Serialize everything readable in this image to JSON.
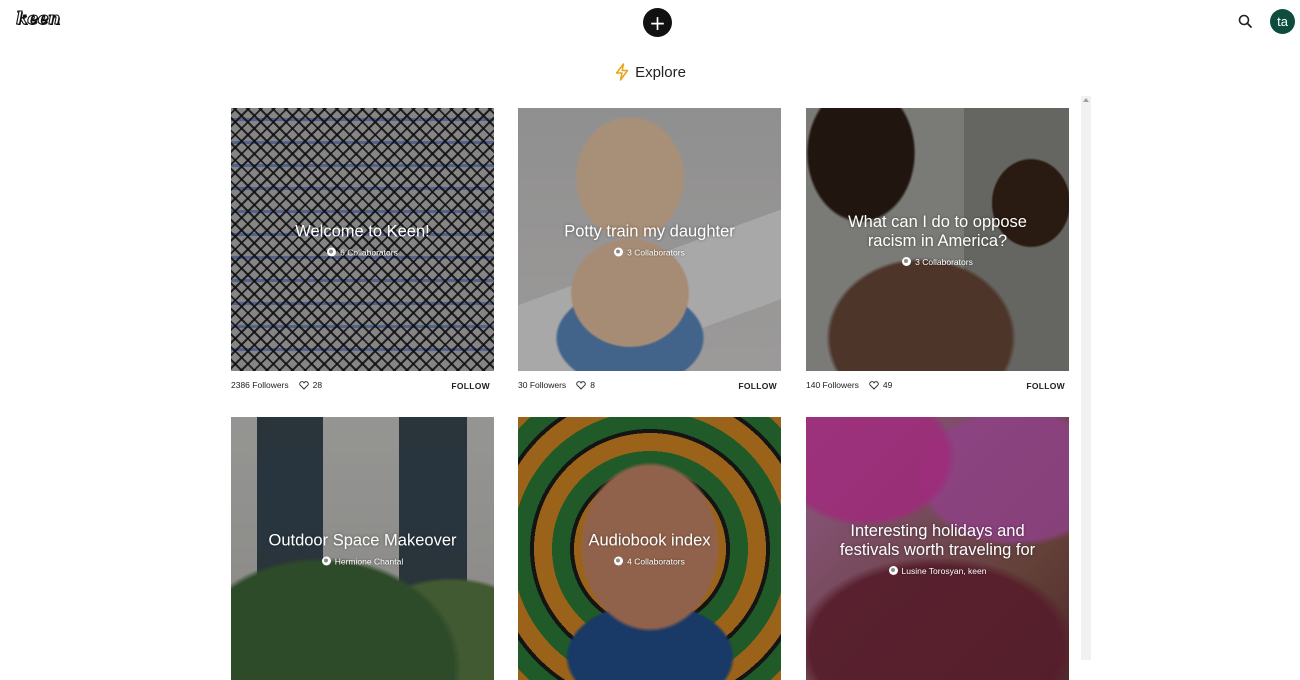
{
  "header": {
    "logo_text": "keen",
    "add_label": "+",
    "avatar_initials": "ta",
    "avatar_color": "#0e4d3d"
  },
  "explore": {
    "title": "Explore",
    "icon": "lightning-icon",
    "icon_color": "#e8a317"
  },
  "cards": [
    {
      "title": "Welcome to Keen!",
      "subtitle": "6 Collaborators",
      "followers": "2386 Followers",
      "likes": "28",
      "follow_label": "FOLLOW"
    },
    {
      "title": "Potty train my daughter",
      "subtitle": "3 Collaborators",
      "followers": "30 Followers",
      "likes": "8",
      "follow_label": "FOLLOW"
    },
    {
      "title": "What can I do to oppose racism in America?",
      "subtitle": "3 Collaborators",
      "followers": "140 Followers",
      "likes": "49",
      "follow_label": "FOLLOW"
    },
    {
      "title": "Outdoor Space Makeover",
      "subtitle": "Hermione Chantal"
    },
    {
      "title": "Audiobook index",
      "subtitle": "4 Collaborators"
    },
    {
      "title": "Interesting holidays and festivals worth traveling for",
      "subtitle": "Lusine Torosyan, keen"
    }
  ]
}
